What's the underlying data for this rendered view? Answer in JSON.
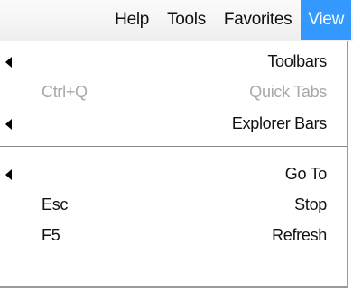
{
  "menubar": {
    "items": [
      {
        "label": "View"
      },
      {
        "label": "Favorites"
      },
      {
        "label": "Tools"
      },
      {
        "label": "Help"
      }
    ]
  },
  "dropdown": {
    "items": [
      {
        "label": "Toolbars",
        "shortcut": "",
        "submenu": true,
        "disabled": false
      },
      {
        "label": "Quick Tabs",
        "shortcut": "Ctrl+Q",
        "submenu": false,
        "disabled": true
      },
      {
        "label": "Explorer Bars",
        "shortcut": "",
        "submenu": true,
        "disabled": false
      },
      {
        "label": "Go To",
        "shortcut": "",
        "submenu": true,
        "disabled": false
      },
      {
        "label": "Stop",
        "shortcut": "Esc",
        "submenu": false,
        "disabled": false
      },
      {
        "label": "Refresh",
        "shortcut": "F5",
        "submenu": false,
        "disabled": false
      }
    ]
  },
  "colors": {
    "accent": "#3399ff",
    "disabled_text": "#a8a8a8"
  }
}
